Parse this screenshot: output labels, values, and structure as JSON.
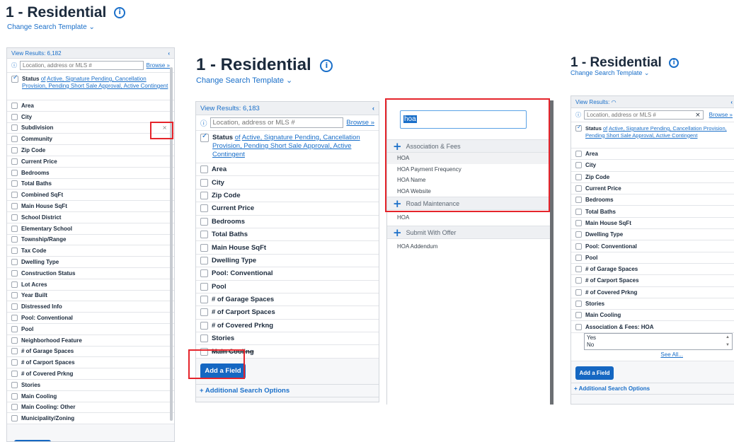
{
  "title": "1 - Residential",
  "change_template": "Change Search Template",
  "browse": "Browse »",
  "search_placeholder": "Location, address or MLS #",
  "status_label": "Status",
  "status_of": "of",
  "status_values": "Active, Signature Pending, Cancellation Provision, Pending Short Sale Approval, Active Contingent",
  "add_field": "Add a Field",
  "additional_options": "+ Additional Search Options",
  "panel1": {
    "view_results": "View Results: 6,182",
    "fields": [
      "Area",
      "City",
      "Subdivision",
      "Community",
      "Zip Code",
      "Current Price",
      "Bedrooms",
      "Total Baths",
      "Combined SqFt",
      "Main House SqFt",
      "School District",
      "Elementary School",
      "Township/Range",
      "Tax Code",
      "Dwelling Type",
      "Construction Status",
      "Lot Acres",
      "Year Built",
      "Distressed Info",
      "Pool: Conventional",
      "Pool",
      "Neighborhood Feature",
      "# of Garage Spaces",
      "# of Carport Spaces",
      "# of Covered Prkng",
      "Stories",
      "Main Cooling",
      "Main Cooling: Other",
      "Municipality/Zoning"
    ],
    "remove_icon": "×"
  },
  "panel2": {
    "view_results": "View Results: 6,183",
    "fields": [
      "Area",
      "City",
      "Zip Code",
      "Current Price",
      "Bedrooms",
      "Total Baths",
      "Main House SqFt",
      "Dwelling Type",
      "Pool: Conventional",
      "Pool",
      "# of Garage Spaces",
      "# of Carport Spaces",
      "# of Covered Prkng",
      "Stories",
      "Main Cooling"
    ]
  },
  "dropdown": {
    "query": "hoa",
    "groups": [
      {
        "name": "Association & Fees",
        "options": [
          "HOA",
          "HOA Payment Frequency",
          "HOA Name",
          "HOA Website"
        ]
      },
      {
        "name": "Road Maintenance",
        "options": [
          "HOA"
        ]
      },
      {
        "name": "Submit With Offer",
        "options": [
          "HOA Addendum"
        ]
      }
    ]
  },
  "panel3": {
    "view_results": "View Results:",
    "fields": [
      "Area",
      "City",
      "Zip Code",
      "Current Price",
      "Bedrooms",
      "Total Baths",
      "Main House SqFt",
      "Dwelling Type",
      "Pool: Conventional",
      "Pool",
      "# of Garage Spaces",
      "# of Carport Spaces",
      "# of Covered Prkng",
      "Stories",
      "Main Cooling",
      "Association & Fees: HOA"
    ],
    "hoa_choices": [
      "Yes",
      "No"
    ],
    "see_all": "See All..."
  },
  "colors": {
    "accent": "#1a6fc9",
    "button": "#1567c2",
    "highlight": "#e5242b"
  }
}
